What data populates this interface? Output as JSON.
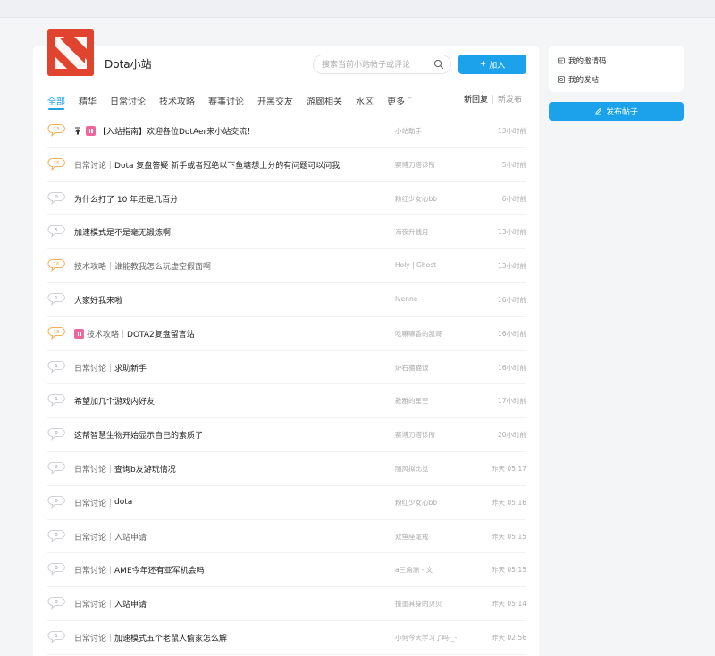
{
  "header": {
    "site_name": "Dota小站",
    "search_placeholder": "搜索当前小站帖子或评论",
    "join_label": "加入"
  },
  "tabs": [
    {
      "label": "全部",
      "active": true
    },
    {
      "label": "精华"
    },
    {
      "label": "日常讨论"
    },
    {
      "label": "技术攻略"
    },
    {
      "label": "赛事讨论"
    },
    {
      "label": "开黑交友"
    },
    {
      "label": "游廊相关"
    },
    {
      "label": "水区"
    },
    {
      "label": "更多"
    }
  ],
  "sort": {
    "newest_reply": "新回复",
    "newest_post": "新发布"
  },
  "posts": [
    {
      "count": "13",
      "hot": true,
      "pinned": true,
      "essence": true,
      "category": "",
      "title": "【入站指南】欢迎各位DotAer来小站交流！",
      "author": "小站助手",
      "time": "13小时前"
    },
    {
      "count": "25",
      "hot": true,
      "pinned": false,
      "essence": false,
      "category": "日常讨论",
      "title": "Dota 复盘答疑 新手或者冠绝以下鱼塘想上分的有问题可以问我",
      "author": "赛博刀塔诊所",
      "time": "5小时前"
    },
    {
      "count": "0",
      "hot": false,
      "pinned": false,
      "essence": false,
      "category": "",
      "title": "为什么打了 10 年还是几百分",
      "author": "粉红少女心bb",
      "time": "6小时前"
    },
    {
      "count": "5",
      "hot": false,
      "pinned": false,
      "essence": false,
      "category": "",
      "title": "加速模式是不是毫无锻炼啊",
      "author": "海夜升銭月",
      "time": "13小时前"
    },
    {
      "count": "16",
      "hot": true,
      "pinned": false,
      "essence": false,
      "category": "技术攻略",
      "title": "谁能教我怎么玩虚空假面啊",
      "author": "Holy | Ghost",
      "time": "13小时前",
      "muted": true
    },
    {
      "count": "1",
      "hot": false,
      "pinned": false,
      "essence": false,
      "category": "",
      "title": "大家好我来啦",
      "author": "Ivenne",
      "time": "16小时前"
    },
    {
      "count": "13",
      "hot": true,
      "pinned": false,
      "essence": true,
      "category": "技术攻略",
      "title": "DOTA2复盘留言站",
      "author": "吃嘛嘛香的凯哥",
      "time": "16小时前"
    },
    {
      "count": "1",
      "hot": false,
      "pinned": false,
      "essence": false,
      "category": "日常讨论",
      "title": "求助新手",
      "author": "炉石猫猫饭",
      "time": "16小时前"
    },
    {
      "count": "1",
      "hot": false,
      "pinned": false,
      "essence": false,
      "category": "",
      "title": "希望加几个游戏内好友",
      "author": "教雅的星空",
      "time": "17小时前"
    },
    {
      "count": "0",
      "hot": false,
      "pinned": false,
      "essence": false,
      "category": "",
      "title": "这帮智慧生物开始显示自己的素质了",
      "author": "赛博刀塔诊所",
      "time": "20小时前"
    },
    {
      "count": "0",
      "hot": false,
      "pinned": false,
      "essence": false,
      "category": "日常讨论",
      "title": "查询b友游玩情况",
      "author": "随风拟比觉",
      "time": "昨天 05:17"
    },
    {
      "count": "0",
      "hot": false,
      "pinned": false,
      "essence": false,
      "category": "日常讨论",
      "title": "dota",
      "author": "粉红少女心bb",
      "time": "昨天 05:16"
    },
    {
      "count": "0",
      "hot": false,
      "pinned": false,
      "essence": false,
      "category": "日常讨论",
      "title": "入站申请",
      "author": "双鱼座尾戒",
      "time": "昨天 05:15",
      "muted": true
    },
    {
      "count": "0",
      "hot": false,
      "pinned": false,
      "essence": false,
      "category": "日常讨论",
      "title": "AME今年还有亚军机会吗",
      "author": "a三角洲 - 文",
      "time": "昨天 05:15"
    },
    {
      "count": "0",
      "hot": false,
      "pinned": false,
      "essence": false,
      "category": "日常讨论",
      "title": "入站申请",
      "author": "撞墨其身的贝贝",
      "time": "昨天 05:14"
    },
    {
      "count": "1",
      "hot": false,
      "pinned": false,
      "essence": false,
      "category": "日常讨论",
      "title": "加速模式五个老鼠人偷家怎么解",
      "author": "小何今天学习了吗-_-",
      "time": "昨天 02:56"
    }
  ],
  "sidebar": {
    "invite_code": "我的邀请码",
    "my_posts": "我的发帖",
    "post_button": "发布帖子"
  },
  "colors": {
    "accent": "#1ba2eb",
    "hot": "#f0a53c",
    "essence": "#f0659a",
    "logo": "#e0442e"
  }
}
